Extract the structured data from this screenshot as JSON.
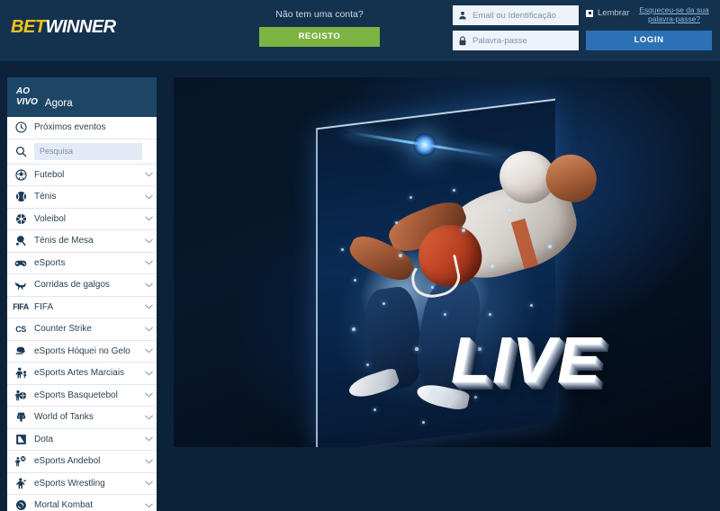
{
  "brand": {
    "logo_part1": "BET",
    "logo_part2": "WINNER",
    "color_accent": "#f5c518",
    "color_header": "#14314e",
    "color_register": "#7cb342",
    "color_login": "#2a72b5",
    "color_sidebar_header": "#1c4566",
    "color_page_bg": "#0c2238"
  },
  "header": {
    "no_account_text": "Não tem uma conta?",
    "register_label": "REGISTO",
    "email_placeholder": "Email ou Identificação",
    "email_value": "",
    "email_icon": "user-icon",
    "password_placeholder": "Palavra-passe",
    "password_value": "",
    "password_icon": "lock-icon",
    "remember_label": "Lembrar",
    "remember_checked": true,
    "forgot_link": "Esqueceu-se da sua palavra-passe?",
    "login_label": "LOGIN"
  },
  "sidebar": {
    "header_badge": "AO\nVIVO",
    "header_title": "Agora",
    "upcoming": {
      "label": "Próximos eventos",
      "icon": "clock-icon"
    },
    "search": {
      "placeholder": "Pesquisa",
      "value": "",
      "icon": "search-icon"
    },
    "items": [
      {
        "label": "Futebol",
        "icon": "soccer-ball-icon"
      },
      {
        "label": "Ténis",
        "icon": "tennis-ball-icon"
      },
      {
        "label": "Voleibol",
        "icon": "volleyball-icon"
      },
      {
        "label": "Ténis de Mesa",
        "icon": "table-tennis-icon"
      },
      {
        "label": "eSports",
        "icon": "gamepad-icon"
      },
      {
        "label": "Corridas de galgos",
        "icon": "greyhound-icon"
      },
      {
        "label": "FIFA",
        "icon": "fifa-icon"
      },
      {
        "label": "Counter Strike",
        "icon": "counter-strike-icon"
      },
      {
        "label": "eSports Hóquei no Gelo",
        "icon": "ice-hockey-icon"
      },
      {
        "label": "eSports Artes Marciais",
        "icon": "martial-arts-icon"
      },
      {
        "label": "eSports Basquetebol",
        "icon": "basketball-icon"
      },
      {
        "label": "World of Tanks",
        "icon": "tank-icon"
      },
      {
        "label": "Dota",
        "icon": "dota-icon"
      },
      {
        "label": "eSports Andebol",
        "icon": "handball-icon"
      },
      {
        "label": "eSports Wrestling",
        "icon": "wrestling-icon"
      },
      {
        "label": "Mortal Kombat",
        "icon": "mortal-kombat-icon"
      }
    ],
    "chevron_icon": "chevron-down-icon"
  },
  "hero": {
    "headline": "LIVE",
    "alt": "american-football-player-tv-banner"
  }
}
